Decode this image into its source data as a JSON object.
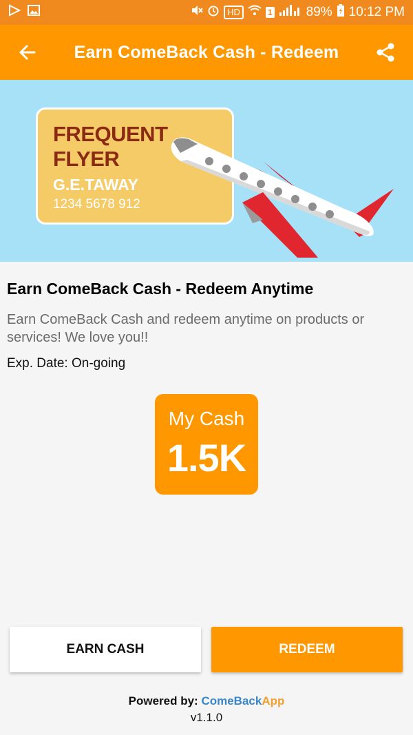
{
  "status_bar": {
    "icons_left": [
      "play-store-icon",
      "gallery-icon"
    ],
    "icons_right": [
      "mute-icon",
      "alarm-icon",
      "wifi-icon",
      "signal-icon"
    ],
    "hd_label": "HD",
    "sim_label": "1",
    "battery": "89%",
    "time": "10:12 PM"
  },
  "app_bar": {
    "title": "Earn ComeBack Cash - Redeem",
    "back_icon": "arrow-left-icon",
    "share_icon": "share-icon",
    "color": "#ff9800"
  },
  "banner": {
    "card_line1": "FREQUENT",
    "card_line2": "FLYER",
    "card_name": "G.E.TAWAY",
    "card_number": "1234 5678 912",
    "background": "#a6e1f7"
  },
  "offer": {
    "headline": "Earn ComeBack Cash - Redeem Anytime",
    "description": "Earn ComeBack Cash and redeem anytime on products or services! We love you!!",
    "expiry": "Exp. Date: On-going"
  },
  "cash": {
    "label": "My Cash",
    "value": "1.5K"
  },
  "actions": {
    "earn_label": "EARN CASH",
    "redeem_label": "REDEEM"
  },
  "footer": {
    "powered_label": "Powered by:",
    "brand_part1": "ComeBack",
    "brand_part2": "App",
    "version": "v1.1.0"
  }
}
